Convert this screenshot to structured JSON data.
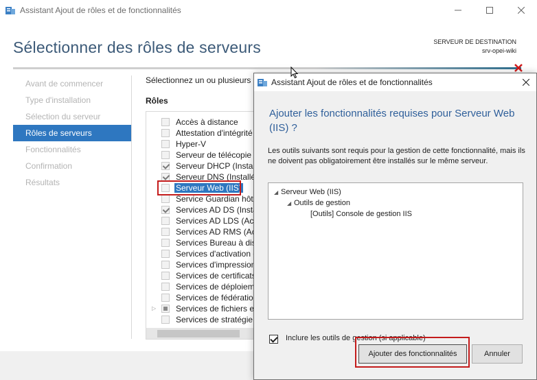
{
  "main_window": {
    "title": "Assistant Ajout de rôles et de fonctionnalités",
    "page_title": "Sélectionner des rôles de serveurs",
    "destination": {
      "label": "SERVEUR DE DESTINATION",
      "server": "srv-opei-wiki"
    },
    "nav": [
      {
        "label": "Avant de commencer",
        "active": false
      },
      {
        "label": "Type d'installation",
        "active": false
      },
      {
        "label": "Sélection du serveur",
        "active": false
      },
      {
        "label": "Rôles de serveurs",
        "active": true
      },
      {
        "label": "Fonctionnalités",
        "active": false
      },
      {
        "label": "Confirmation",
        "active": false
      },
      {
        "label": "Résultats",
        "active": false
      }
    ],
    "instruction": "Sélectionnez un ou plusieurs r",
    "roles_label": "Rôles",
    "roles": [
      {
        "label": "Accès à distance",
        "state": "unchecked"
      },
      {
        "label": "Attestation d'intégrité",
        "state": "unchecked"
      },
      {
        "label": "Hyper-V",
        "state": "unchecked"
      },
      {
        "label": "Serveur de télécopie",
        "state": "unchecked"
      },
      {
        "label": "Serveur DHCP (Installé",
        "state": "checked"
      },
      {
        "label": "Serveur DNS (Installé)",
        "state": "checked"
      },
      {
        "label": "Serveur Web (IIS)",
        "state": "unchecked",
        "selected": true
      },
      {
        "label": "Service Guardian hôte",
        "state": "unchecked"
      },
      {
        "label": "Services AD DS (Install",
        "state": "checked"
      },
      {
        "label": "Services AD LDS (Acti",
        "state": "unchecked"
      },
      {
        "label": "Services AD RMS (Acti",
        "state": "unchecked"
      },
      {
        "label": "Services Bureau à dist",
        "state": "unchecked"
      },
      {
        "label": "Services d'activation e",
        "state": "unchecked"
      },
      {
        "label": "Services d'impression",
        "state": "unchecked"
      },
      {
        "label": "Services de certificats",
        "state": "unchecked"
      },
      {
        "label": "Services de déploieme",
        "state": "unchecked"
      },
      {
        "label": "Services de fédération",
        "state": "unchecked"
      },
      {
        "label": "Services de fichiers et",
        "state": "partial",
        "expandable": true
      },
      {
        "label": "Services de stratégie d",
        "state": "unchecked"
      }
    ]
  },
  "dialog": {
    "title": "Assistant Ajout de rôles et de fonctionnalités",
    "heading": "Ajouter les fonctionnalités requises pour Serveur Web (IIS) ?",
    "description": "Les outils suivants sont requis pour la gestion de cette fonctionnalité, mais ils ne doivent pas obligatoirement être installés sur le même serveur.",
    "tree": [
      {
        "label": "Serveur Web (IIS)",
        "level": 0,
        "expanded": true
      },
      {
        "label": "Outils de gestion",
        "level": 1,
        "expanded": true
      },
      {
        "label": "[Outils] Console de gestion IIS",
        "level": 2,
        "expanded": false
      }
    ],
    "include_tools_label": "Inclure les outils de gestion (si applicable)",
    "include_tools_checked": true,
    "add_button": "Ajouter des fonctionnalités",
    "cancel_button": "Annuler"
  },
  "colors": {
    "accent": "#2e77c0",
    "heading": "#3c5a78",
    "highlight": "#c41b1b"
  }
}
